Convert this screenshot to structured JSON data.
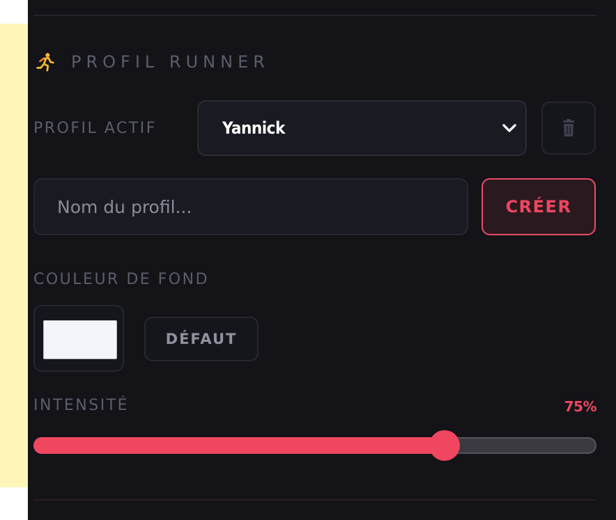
{
  "profile_section": {
    "icon": "running-person-icon",
    "title": "PROFIL RUNNER",
    "active_profile_label": "PROFIL ACTIF",
    "active_profile_value": "Yannick",
    "delete_icon": "trash-icon",
    "name_input_placeholder": "Nom du profil...",
    "name_input_value": "",
    "create_label": "CRÉER"
  },
  "background_section": {
    "title": "COULEUR DE FOND",
    "swatch_color": "#f4f5fa",
    "default_label": "DÉFAUT"
  },
  "intensity": {
    "label": "INTENSITÉ",
    "value_text": "75%",
    "value": 0.73
  },
  "colors": {
    "panel_background": "#131318",
    "accent": "#f0465f",
    "side_panel": "#fdf6b8"
  }
}
